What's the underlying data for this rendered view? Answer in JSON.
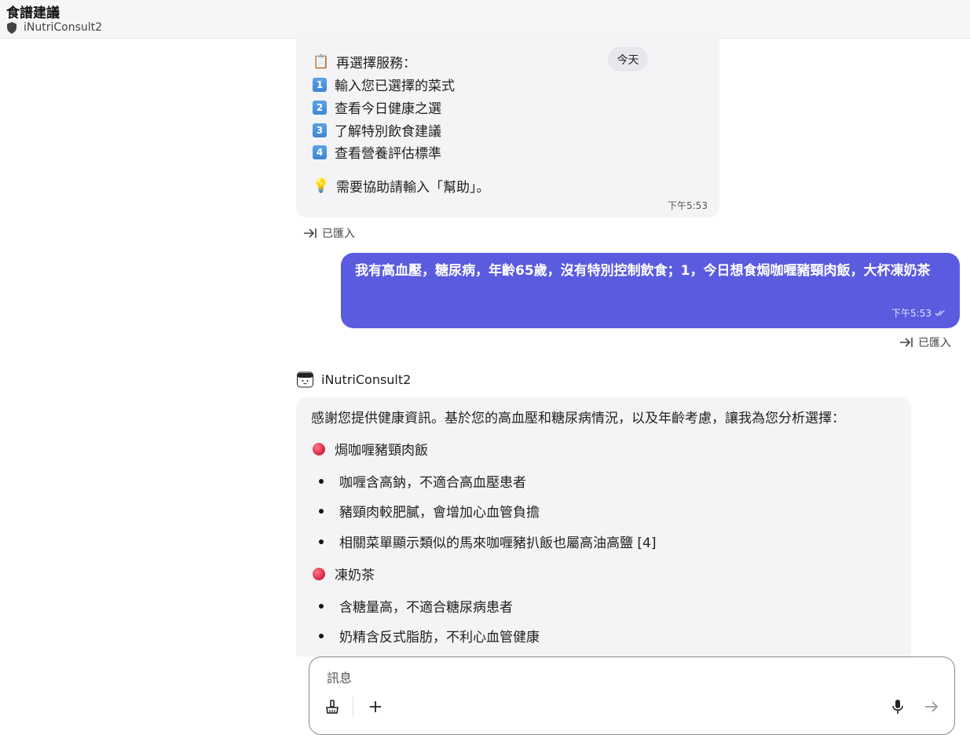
{
  "header": {
    "title": "食譜建議",
    "subtitle": "iNutriConsult2"
  },
  "today_label": "今天",
  "first_message": {
    "heading": "再選擇服務：",
    "heading_emoji": "📋",
    "options": [
      {
        "key": "1",
        "label": "輸入您已選擇的菜式"
      },
      {
        "key": "2",
        "label": "查看今日健康之選"
      },
      {
        "key": "3",
        "label": "了解特別飲食建議"
      },
      {
        "key": "4",
        "label": "查看營養評估標準"
      }
    ],
    "help_emoji": "💡",
    "help_text": "需要協助請輸入「幫助」。",
    "time": "下午5:53"
  },
  "imported_label": "已匯入",
  "user_message": {
    "text": "我有高血壓，糖尿病，年齡65歲，沒有特別控制飲食；1，今日想食焗咖喱豬頸肉飯，大杯凍奶茶",
    "time": "下午5:53"
  },
  "bot": {
    "name": "iNutriConsult2",
    "intro": "感謝您提供健康資訊。基於您的高血壓和糖尿病情況，以及年齡考慮，讓我為您分析選擇：",
    "sections": [
      {
        "title": "焗咖喱豬頸肉飯",
        "bullets": [
          "咖喱含高鈉，不適合高血壓患者",
          "豬頸肉較肥膩，會增加心血管負擔",
          "相關菜單顯示類似的馬來咖喱豬扒飯也屬高油高鹽 [4]"
        ]
      },
      {
        "title": "凍奶茶",
        "bullets": [
          "含糖量高，不適合糖尿病患者",
          "奶精含反式脂肪，不利心血管健康"
        ]
      }
    ]
  },
  "composer": {
    "placeholder": "訊息"
  },
  "colors": {
    "user_bubble": "#5b5be0",
    "bot_bubble": "#f4f4f6",
    "header_bg": "#f6f6f6"
  }
}
